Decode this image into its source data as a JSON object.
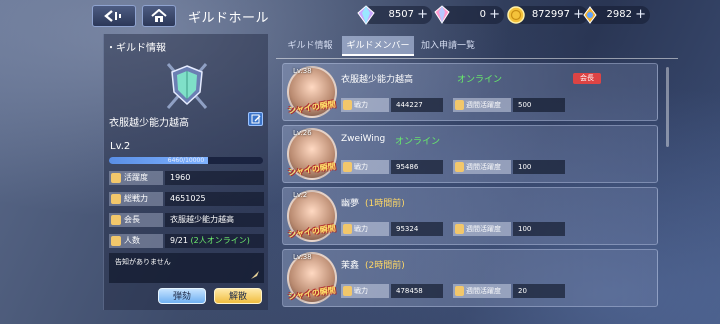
{
  "header": {
    "title": "ギルドホール",
    "resources": [
      {
        "icon": "crystal-icon",
        "value": "8507"
      },
      {
        "icon": "gem-icon",
        "value": "0"
      },
      {
        "icon": "gold-coin-icon",
        "value": "872997"
      },
      {
        "icon": "stamina-icon",
        "value": "2982"
      }
    ],
    "plus": "+"
  },
  "guild_info": {
    "section_title": "・ギルド情報",
    "name": "衣服越少能力越高",
    "level": "Lv.2",
    "exp_text": "6460/10000",
    "exp_fraction": 0.646,
    "stats": [
      {
        "label": "活躍度",
        "value": "1960"
      },
      {
        "label": "総戦力",
        "value": "4651025"
      },
      {
        "label": "会長",
        "value": "衣服越少能力越高"
      },
      {
        "label": "人数",
        "value": "9/21",
        "extra": "(2人オンライン)"
      }
    ],
    "notice": "告知がありません",
    "kick_button": "弾劾",
    "disband_button": "解散"
  },
  "tabs": [
    "ギルド情報",
    "ギルドメンバー",
    "加入申請一覧"
  ],
  "members": [
    {
      "lv": "Lv.38",
      "name": "衣服越少能力越高",
      "status": "オンライン",
      "status_type": "on",
      "role": "会長",
      "power_label": "戦力",
      "power": "444227",
      "weekly_label": "週間活躍度",
      "weekly": "500",
      "badge": "シャイの瞬間"
    },
    {
      "lv": "Lv.26",
      "name": "ZweiWing",
      "status": "オンライン",
      "status_type": "on",
      "role": "",
      "power_label": "戦力",
      "power": "95486",
      "weekly_label": "週間活躍度",
      "weekly": "100",
      "badge": "シャイの瞬間"
    },
    {
      "lv": "Lv.2",
      "name": "幽夢",
      "status": "(1時間前)",
      "status_type": "off",
      "role": "",
      "power_label": "戦力",
      "power": "95324",
      "weekly_label": "週間活躍度",
      "weekly": "100",
      "badge": "シャイの瞬間"
    },
    {
      "lv": "Lv.38",
      "name": "茉鑫",
      "status": "(2時間前)",
      "status_type": "off",
      "role": "",
      "power_label": "戦力",
      "power": "478458",
      "weekly_label": "週間活躍度",
      "weekly": "20",
      "badge": "シャイの瞬間"
    }
  ],
  "colors": {
    "online": "#68f06a",
    "offline": "#ffd866",
    "leader": "#dd4444"
  }
}
